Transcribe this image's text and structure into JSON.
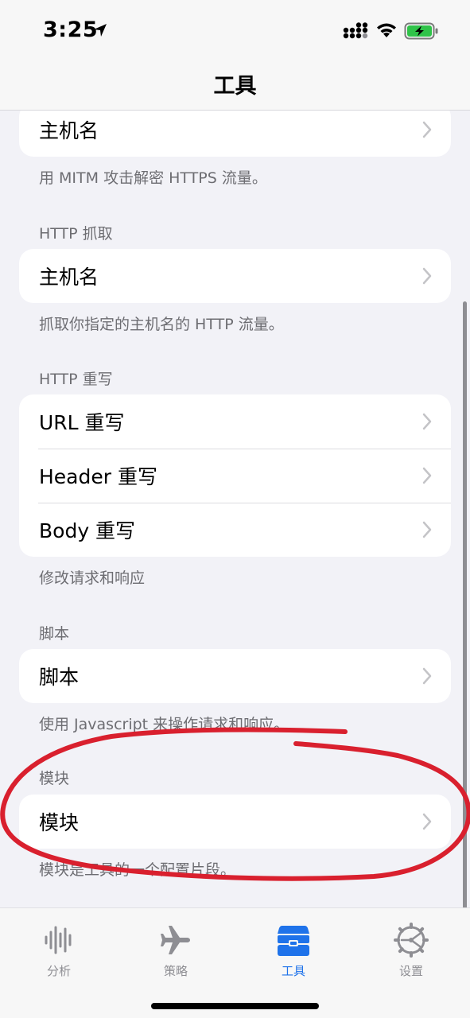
{
  "status_bar": {
    "time": "3:25"
  },
  "nav": {
    "title": "工具"
  },
  "sections": {
    "mitm": {
      "rows": [
        "主机名"
      ],
      "footer": "用 MITM 攻击解密 HTTPS 流量。"
    },
    "http_capture": {
      "header": "HTTP 抓取",
      "rows": [
        "主机名"
      ],
      "footer": "抓取你指定的主机名的 HTTP 流量。"
    },
    "http_rewrite": {
      "header": "HTTP 重写",
      "rows": [
        "URL 重写",
        "Header 重写",
        "Body 重写"
      ],
      "footer": "修改请求和响应"
    },
    "script": {
      "header": "脚本",
      "rows": [
        "脚本"
      ],
      "footer": "使用 Javascript 来操作请求和响应。"
    },
    "module": {
      "header": "模块",
      "rows": [
        "模块"
      ],
      "footer": "模块是工具的一个配置片段。"
    }
  },
  "tab_bar": {
    "items": [
      {
        "label": "分析",
        "icon": "waveform-icon",
        "active": false
      },
      {
        "label": "策略",
        "icon": "airplane-icon",
        "active": false
      },
      {
        "label": "工具",
        "icon": "toolbox-icon",
        "active": true
      },
      {
        "label": "设置",
        "icon": "gear-icon",
        "active": false
      }
    ]
  },
  "colors": {
    "accent": "#1f73ea",
    "annotation": "#d9202e",
    "background": "#f2f2f7",
    "secondary_text": "#6d6d72"
  }
}
